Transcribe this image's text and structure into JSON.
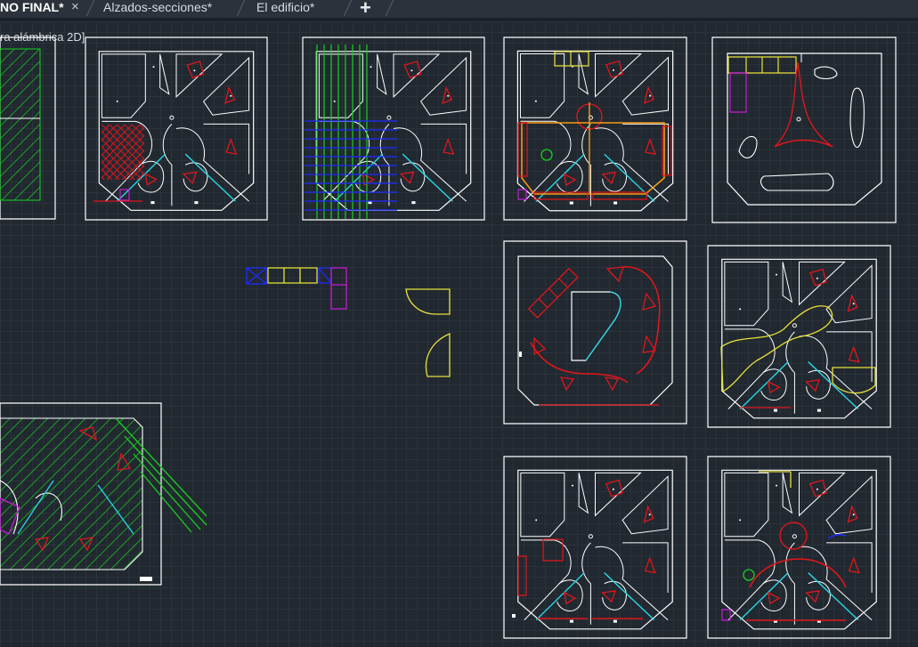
{
  "tabs": [
    {
      "label": "NO FINAL*",
      "active": true
    },
    {
      "label": "Alzados-secciones*",
      "active": false
    },
    {
      "label": "El edificio*",
      "active": false
    }
  ],
  "tab_close_glyph": "×",
  "tab_add_glyph": "+",
  "viewport": {
    "label": "ra alámbrica 2D]"
  },
  "colors": {
    "background": "#212830",
    "white": "#ffffff",
    "red": "#e0161b",
    "cyan": "#27d6e6",
    "green": "#18d11f",
    "yellow": "#e8e23a",
    "blue": "#1d2bff",
    "magenta": "#c81ad6",
    "orange": "#f59a14"
  }
}
